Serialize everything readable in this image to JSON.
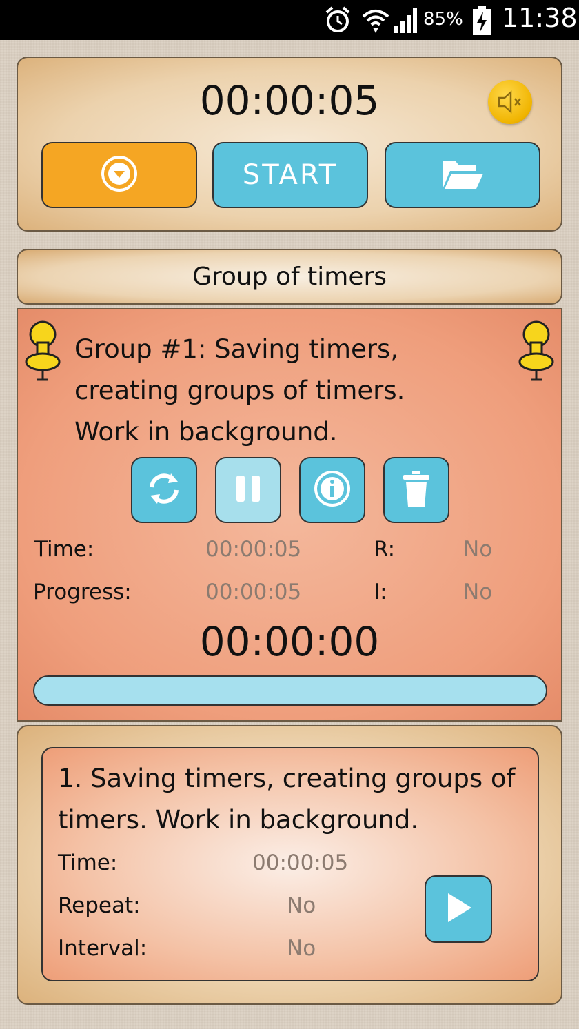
{
  "status_bar": {
    "battery_percent": "85%",
    "clock": "11:38",
    "icons": [
      "alarm-icon",
      "wifi-icon",
      "signal-icon",
      "battery-charging-icon"
    ]
  },
  "top_panel": {
    "main_time": "00:00:05",
    "mute_icon": "speaker-muted-icon",
    "dropdown_icon": "chevron-down-circle-icon",
    "start_label": "START",
    "folder_icon": "folder-open-icon"
  },
  "section_title": "Group of timers",
  "group": {
    "description": "Group #1: Saving timers, creating groups of timers. Work in background.",
    "buttons": [
      "refresh-icon",
      "pause-icon",
      "info-icon",
      "trash-icon"
    ],
    "time_label": "Time:",
    "time_value": "00:00:05",
    "progress_label": "Progress:",
    "progress_value": "00:00:05",
    "r_label": "R:",
    "r_value": "No",
    "i_label": "I:",
    "i_value": "No",
    "remaining": "00:00:00",
    "progress_fraction": 0
  },
  "timer_item": {
    "title": "1. Saving timers, creating groups of timers. Work in background.",
    "time_label": "Time:",
    "time_value": "00:00:05",
    "repeat_label": "Repeat:",
    "repeat_value": "No",
    "interval_label": "Interval:",
    "interval_value": "No",
    "play_icon": "play-icon"
  },
  "colors": {
    "orange": "#f5a623",
    "blue": "#5bc3dc",
    "light_blue": "#a7dfec",
    "group_card": "#ef9e7c",
    "mute_yellow": "#f0b400"
  }
}
